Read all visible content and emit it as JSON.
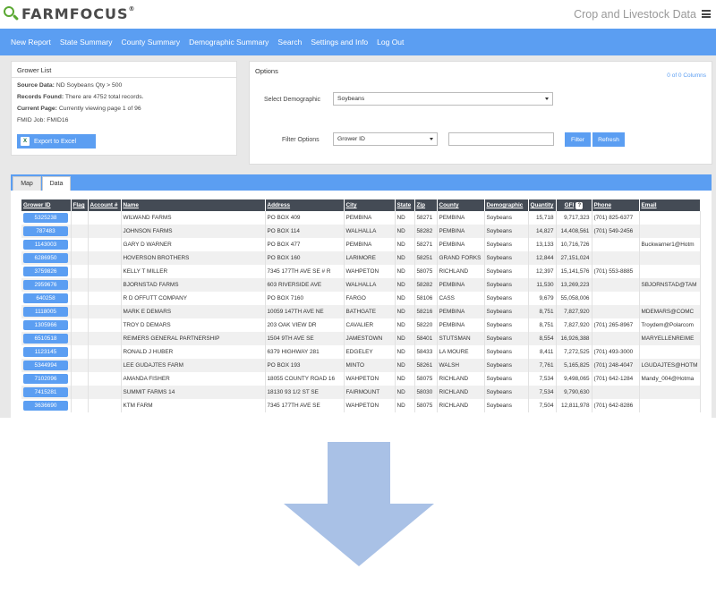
{
  "brand": {
    "name": "FARMFOCUS",
    "tm": "®"
  },
  "header": {
    "title": "Crop and Livestock Data"
  },
  "nav": [
    "New Report",
    "State Summary",
    "County Summary",
    "Demographic Summary",
    "Search",
    "Settings and Info",
    "Log Out"
  ],
  "grower_list": {
    "title": "Grower List",
    "source_label": "Source Data:",
    "source_value": "ND Soybeans Qty > 500",
    "records_label": "Records Found:",
    "records_value": "There are 4752 total records.",
    "page_label": "Current Page:",
    "page_value": "Currently viewing page 1 of 96",
    "fmid_label": "FMID Job:",
    "fmid_value": "FMID16",
    "export_label": "Export to Excel"
  },
  "options": {
    "title": "Options",
    "columns_link": "0 of 0 Columns",
    "demographic_label": "Select Demographic",
    "demographic_value": "Soybeans",
    "filter_label": "Filter Options",
    "filter_value": "Grower ID",
    "filter_button": "Filter",
    "refresh_button": "Refresh"
  },
  "tabs": [
    "Map",
    "Data"
  ],
  "table": {
    "headers": [
      "Grower ID",
      "Flag",
      "Account #",
      "Name",
      "Address",
      "City",
      "State",
      "Zip",
      "County",
      "Demographic",
      "Quantity",
      "GFI",
      "Phone",
      "Email"
    ],
    "rows": [
      [
        "5325238",
        "",
        "",
        "WILWAND FARMS",
        "PO BOX 409",
        "PEMBINA",
        "ND",
        "58271",
        "PEMBINA",
        "Soybeans",
        "15,718",
        "9,717,323",
        "(701) 825-6377",
        ""
      ],
      [
        "787483",
        "",
        "",
        "JOHNSON FARMS",
        "PO BOX 114",
        "WALHALLA",
        "ND",
        "58282",
        "PEMBINA",
        "Soybeans",
        "14,827",
        "14,408,561",
        "(701) 549-2456",
        ""
      ],
      [
        "1143003",
        "",
        "",
        "GARY D WARNER",
        "PO BOX 477",
        "PEMBINA",
        "ND",
        "58271",
        "PEMBINA",
        "Soybeans",
        "13,133",
        "10,716,726",
        "",
        "Buckwarner1@Hotm"
      ],
      [
        "6286950",
        "",
        "",
        "HOVERSON BROTHERS",
        "PO BOX 160",
        "LARIMORE",
        "ND",
        "58251",
        "GRAND FORKS",
        "Soybeans",
        "12,844",
        "27,151,024",
        "",
        ""
      ],
      [
        "3759826",
        "",
        "",
        "KELLY T MILLER",
        "7345 177TH AVE SE # R",
        "WAHPETON",
        "ND",
        "58075",
        "RICHLAND",
        "Soybeans",
        "12,397",
        "15,141,576",
        "(701) 553-8885",
        ""
      ],
      [
        "2959676",
        "",
        "",
        "BJORNSTAD FARMS",
        "603 RIVERSIDE AVE",
        "WALHALLA",
        "ND",
        "58282",
        "PEMBINA",
        "Soybeans",
        "11,530",
        "13,269,223",
        "",
        "SBJORNSTAD@TAM"
      ],
      [
        "640258",
        "",
        "",
        "R D OFFUTT COMPANY",
        "PO BOX 7160",
        "FARGO",
        "ND",
        "58106",
        "CASS",
        "Soybeans",
        "9,679",
        "55,058,006",
        "",
        ""
      ],
      [
        "1118005",
        "",
        "",
        "MARK E DEMARS",
        "10059 147TH AVE NE",
        "BATHGATE",
        "ND",
        "58216",
        "PEMBINA",
        "Soybeans",
        "8,751",
        "7,827,920",
        "",
        "MDEMARS@COMC"
      ],
      [
        "1305966",
        "",
        "",
        "TROY D DEMARS",
        "203 OAK VIEW DR",
        "CAVALIER",
        "ND",
        "58220",
        "PEMBINA",
        "Soybeans",
        "8,751",
        "7,827,920",
        "(701) 265-8967",
        "Troydem@Polarcom"
      ],
      [
        "6510518",
        "",
        "",
        "REIMERS GENERAL PARTNERSHIP",
        "1504 9TH AVE SE",
        "JAMESTOWN",
        "ND",
        "58401",
        "STUTSMAN",
        "Soybeans",
        "8,554",
        "16,926,388",
        "",
        "MARYELLENREIME"
      ],
      [
        "1123145",
        "",
        "",
        "RONALD J HUBER",
        "6379 HIGHWAY 281",
        "EDGELEY",
        "ND",
        "58433",
        "LA MOURE",
        "Soybeans",
        "8,411",
        "7,272,525",
        "(701) 493-3000",
        ""
      ],
      [
        "5344994",
        "",
        "",
        "LEE GUDAJTES FARM",
        "PO BOX 193",
        "MINTO",
        "ND",
        "58261",
        "WALSH",
        "Soybeans",
        "7,761",
        "5,165,825",
        "(701) 248-4047",
        "LGUDAJTES@HOTM"
      ],
      [
        "7102096",
        "",
        "",
        "AMANDA FISHER",
        "18055 COUNTY ROAD 16",
        "WAHPETON",
        "ND",
        "58075",
        "RICHLAND",
        "Soybeans",
        "7,534",
        "9,498,065",
        "(701) 642-1284",
        "Mandy_004@Hotma"
      ],
      [
        "7415281",
        "",
        "",
        "SUMMIT FARMS 14",
        "18130 93 1/2 ST SE",
        "FAIRMOUNT",
        "ND",
        "58030",
        "RICHLAND",
        "Soybeans",
        "7,534",
        "9,790,630",
        "",
        ""
      ],
      [
        "3636690",
        "",
        "",
        "KTM FARM",
        "7345 177TH AVE SE",
        "WAHPETON",
        "ND",
        "58075",
        "RICHLAND",
        "Soybeans",
        "7,504",
        "12,811,978",
        "(701) 642-8286",
        ""
      ]
    ]
  },
  "colors": {
    "accent": "#5b9ef2",
    "header_dark": "#444b55",
    "arrow": "#a9c1e6"
  }
}
